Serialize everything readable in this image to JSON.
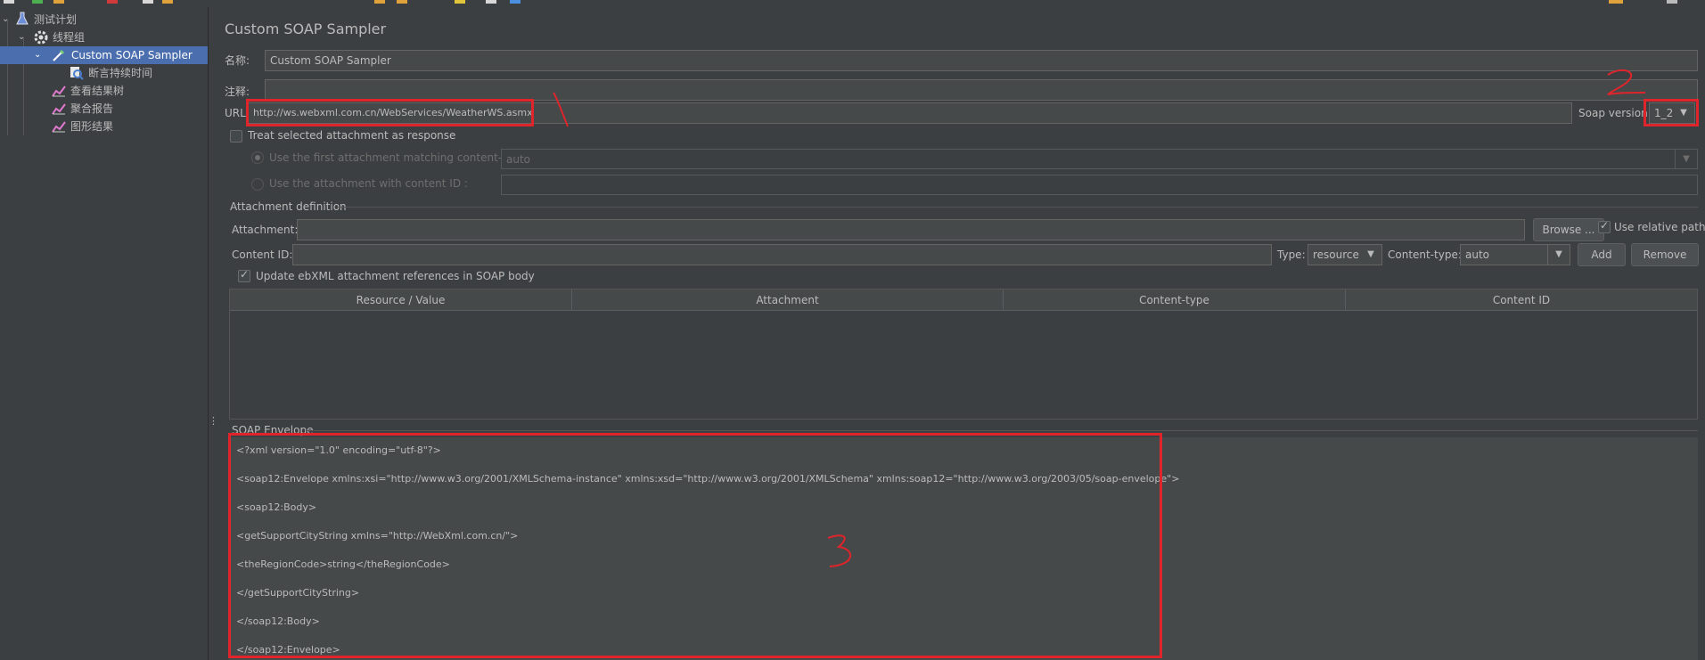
{
  "tree": {
    "items": [
      {
        "label": "测试计划",
        "icon": "flask-icon"
      },
      {
        "label": "线程组",
        "icon": "gear-icon"
      },
      {
        "label": "Custom SOAP Sampler",
        "icon": "pipette-icon"
      },
      {
        "label": "断言持续时间",
        "icon": "assertion-icon"
      },
      {
        "label": "查看结果树",
        "icon": "chart-icon"
      },
      {
        "label": "聚合报告",
        "icon": "chart-icon"
      },
      {
        "label": "图形结果",
        "icon": "chart-icon"
      }
    ]
  },
  "panel": {
    "title": "Custom SOAP Sampler",
    "name_label": "名称:",
    "name_value": "Custom SOAP Sampler",
    "comment_label": "注释:",
    "comment_value": "",
    "url_label": "URL",
    "url_value": "http://ws.webxml.com.cn/WebServices/WeatherWS.asmx",
    "soap_version_label": "Soap version",
    "soap_version_value": "1_2",
    "treat_attachment_label": "Treat selected attachment as response",
    "first_attachment_label": "Use the first attachment matching content-type :",
    "first_attachment_value": "auto",
    "content_id_attachment_label": "Use the attachment with content ID :",
    "attachment_definition_title": "Attachment definition",
    "attachment_label": "Attachment:",
    "browse_label": "Browse ...",
    "use_relative_paths_label": "Use relative paths",
    "content_id_label": "Content ID:",
    "type_label": "Type:",
    "type_value": "resource",
    "content_type_label": "Content-type:",
    "content_type_value": "auto",
    "add_label": "Add",
    "remove_label": "Remove",
    "update_ebxml_label": "Update ebXML attachment references in SOAP body",
    "table_headers": [
      "Resource / Value",
      "Attachment",
      "Content-type",
      "Content ID"
    ],
    "envelope_title": "SOAP Envelope",
    "envelope_lines": [
      "<?xml version=\"1.0\" encoding=\"utf-8\"?>",
      "<soap12:Envelope xmlns:xsi=\"http://www.w3.org/2001/XMLSchema-instance\" xmlns:xsd=\"http://www.w3.org/2001/XMLSchema\" xmlns:soap12=\"http://www.w3.org/2003/05/soap-envelope\">",
      "<soap12:Body>",
      "<getSupportCityString xmlns=\"http://WebXml.com.cn/\">",
      "<theRegionCode>string</theRegionCode>",
      "</getSupportCityString>",
      "</soap12:Body>",
      "</soap12:Envelope>"
    ]
  },
  "annotations": {
    "mark1": "1",
    "mark2": "2",
    "mark3": "3",
    "color": "#e0242b"
  }
}
